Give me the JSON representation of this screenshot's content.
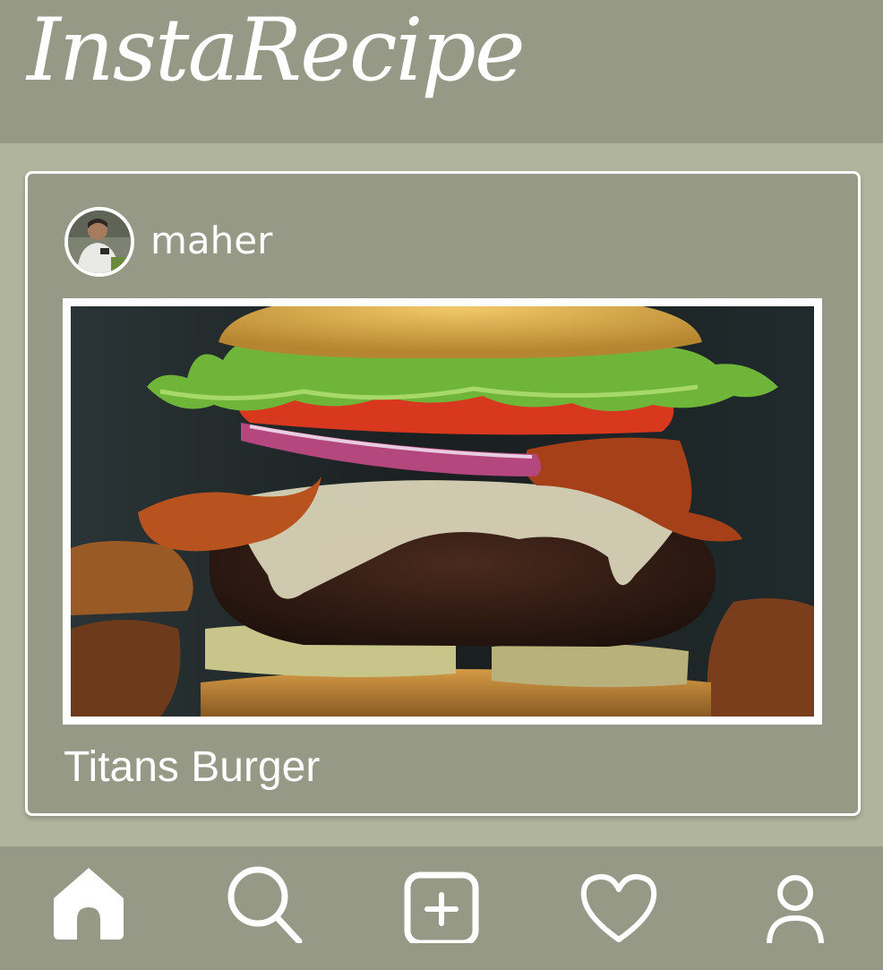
{
  "app": {
    "title": "InstaRecipe"
  },
  "post": {
    "username": "maher",
    "recipe_title": "Titans Burger"
  },
  "nav": {
    "items": [
      {
        "icon": "home-icon",
        "active": true
      },
      {
        "icon": "search-icon",
        "active": false
      },
      {
        "icon": "add-icon",
        "active": false
      },
      {
        "icon": "heart-icon",
        "active": false
      },
      {
        "icon": "profile-icon",
        "active": false
      }
    ]
  },
  "colors": {
    "background": "#b0b49c",
    "header": "#959986",
    "card": "#959986",
    "text": "#ffffff"
  }
}
